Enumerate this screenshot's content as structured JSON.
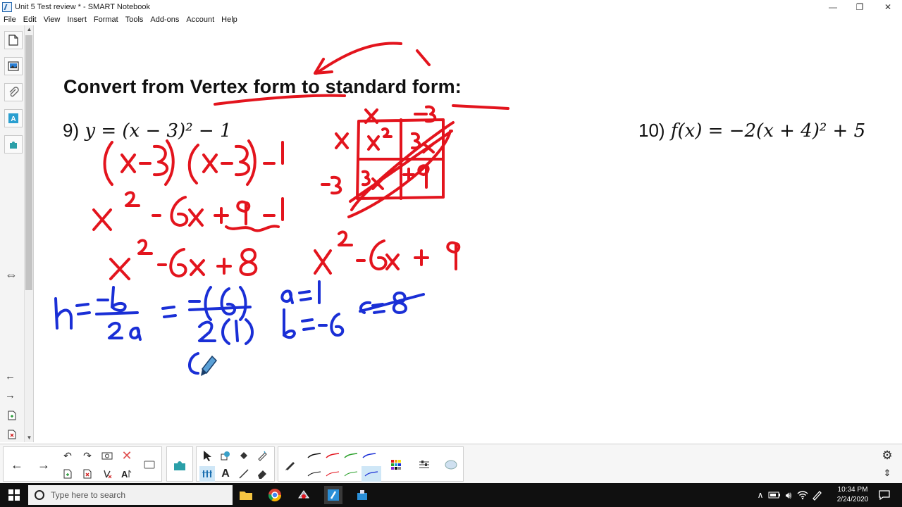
{
  "window": {
    "title": "Unit 5 Test review * - SMART Notebook",
    "minimize_glyph": "—",
    "restore_glyph": "❐",
    "close_glyph": "✕"
  },
  "menu": [
    "File",
    "Edit",
    "View",
    "Insert",
    "Format",
    "Tools",
    "Add-ons",
    "Account",
    "Help"
  ],
  "page": {
    "heading": "Convert from Vertex form to standard form:",
    "problem_9_number": "9)",
    "problem_9_expr": "y = (x − 3)² − 1",
    "problem_10_number": "10)",
    "problem_10_expr": "f(x) = −2(x + 4)² + 5"
  },
  "ink": {
    "red_color": "#e3141d",
    "blue_color": "#1a2fd6"
  },
  "taskbar": {
    "search_placeholder": "Type here to search",
    "clock_time": "10:34 PM",
    "clock_date": "2/24/2020"
  },
  "icons": {
    "side_tabs": [
      "page-sorter-icon",
      "gallery-icon",
      "attachments-icon",
      "properties-icon",
      "add-ons-icon"
    ],
    "resize": "resize-arrows-icon"
  }
}
